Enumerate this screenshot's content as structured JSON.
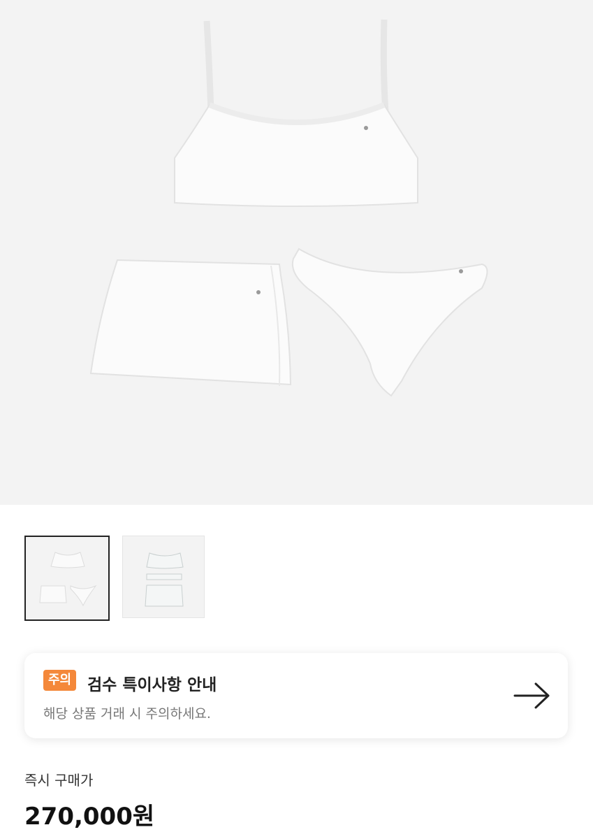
{
  "product": {
    "main_image_alt": "white bralette top, wrap skirt and bikini bottom set",
    "thumbnails": [
      {
        "name": "thumbnail-1",
        "selected": true
      },
      {
        "name": "thumbnail-2",
        "selected": false
      }
    ]
  },
  "notice": {
    "badge": "주의",
    "title": "검수 특이사항 안내",
    "subtitle": "해당 상품 거래 시 주의하세요.",
    "badge_color": "#f4883a"
  },
  "price": {
    "label": "즉시 구매가",
    "value": "270,000원"
  }
}
